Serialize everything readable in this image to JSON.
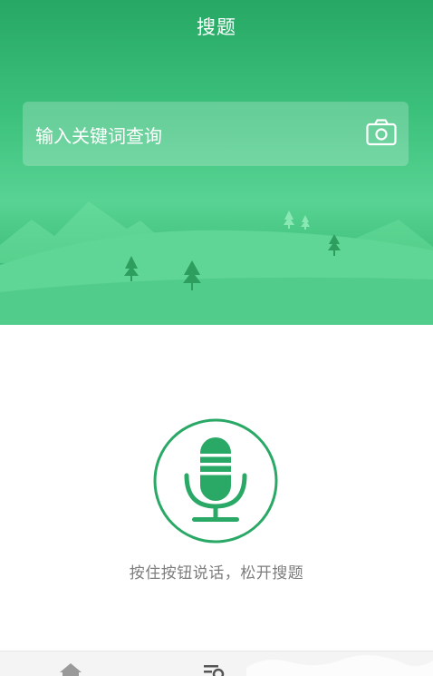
{
  "header": {
    "title": "搜题"
  },
  "search": {
    "placeholder": "输入关键词查询",
    "camera_icon": "camera-icon"
  },
  "voice": {
    "mic_icon": "microphone-icon",
    "hint": "按住按钮说话，松开搜题"
  },
  "bottom_nav": {
    "items": [
      {
        "icon": "home-icon"
      },
      {
        "icon": "list-search-icon"
      }
    ]
  },
  "colors": {
    "accent": "#2aa866",
    "hero_light": "#58d393",
    "hint_text": "#7d7d7d"
  }
}
